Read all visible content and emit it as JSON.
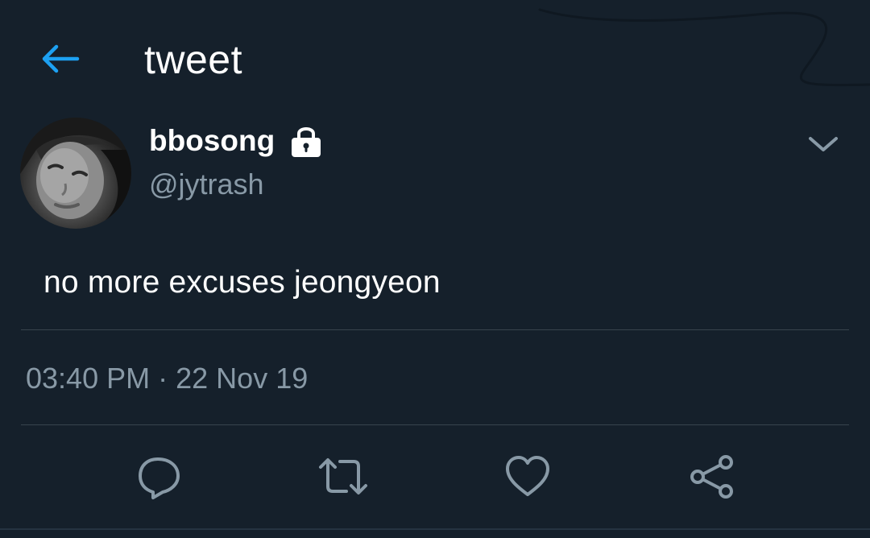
{
  "theme": {
    "background": "#15202b",
    "accent": "#1da1f2",
    "primary_text": "#ffffff",
    "secondary_text": "#8899a6",
    "divider": "#38444d"
  },
  "header": {
    "back_icon": "arrow-left-icon",
    "title": "tweet"
  },
  "author": {
    "avatar_icon": "profile-photo",
    "display_name": "bbosong",
    "protected_icon": "lock-icon",
    "handle": "@jytrash",
    "menu_icon": "chevron-down-icon"
  },
  "tweet": {
    "text": "no more excuses jeongyeon",
    "time": "03:40 PM",
    "separator": "·",
    "date": "22 Nov 19"
  },
  "actions": [
    {
      "icon": "reply-icon"
    },
    {
      "icon": "retweet-icon"
    },
    {
      "icon": "like-icon"
    },
    {
      "icon": "share-icon"
    }
  ]
}
